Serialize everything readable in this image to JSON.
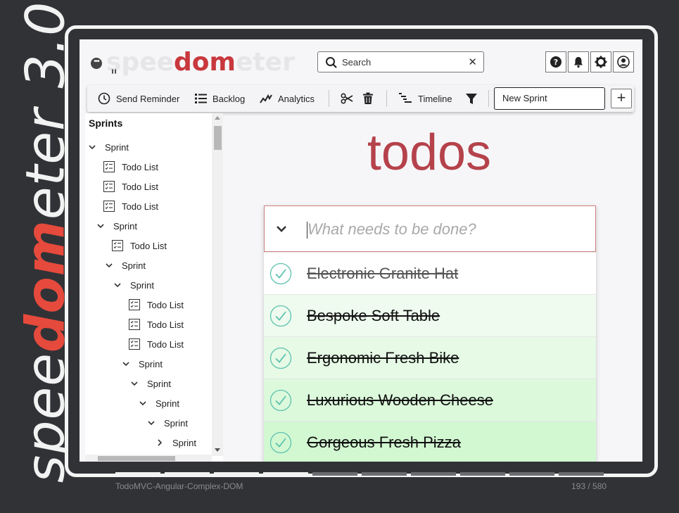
{
  "brand": {
    "pre": "spee",
    "highlight": "dom",
    "post": "eter",
    "version": "3.0"
  },
  "app": {
    "logo_pre": "spee",
    "logo_hl": "dom",
    "logo_post": "eter",
    "logo_mark": "\""
  },
  "search": {
    "value": "Search",
    "clear_icon": "close-icon"
  },
  "header_buttons": [
    "help-icon",
    "bell-icon",
    "gear-icon",
    "user-icon"
  ],
  "toolbar": {
    "send_reminder": "Send Reminder",
    "backlog": "Backlog",
    "analytics": "Analytics",
    "timeline": "Timeline",
    "new_sprint_value": "New Sprint",
    "add_label": "+"
  },
  "sidebar": {
    "title": "Sprints",
    "items": [
      {
        "type": "sprint",
        "label": "Sprint",
        "level": 0,
        "expanded": true
      },
      {
        "type": "todo",
        "label": "Todo List",
        "level": 1
      },
      {
        "type": "todo",
        "label": "Todo List",
        "level": 1
      },
      {
        "type": "todo",
        "label": "Todo List",
        "level": 1
      },
      {
        "type": "sprint",
        "label": "Sprint",
        "level": 1,
        "expanded": true
      },
      {
        "type": "todo",
        "label": "Todo List",
        "level": 2
      },
      {
        "type": "sprint",
        "label": "Sprint",
        "level": 2,
        "expanded": true
      },
      {
        "type": "sprint",
        "label": "Sprint",
        "level": 3,
        "expanded": true
      },
      {
        "type": "todo",
        "label": "Todo List",
        "level": 4
      },
      {
        "type": "todo",
        "label": "Todo List",
        "level": 4
      },
      {
        "type": "todo",
        "label": "Todo List",
        "level": 4
      },
      {
        "type": "sprint",
        "label": "Sprint",
        "level": 4,
        "expanded": true
      },
      {
        "type": "sprint",
        "label": "Sprint",
        "level": 5,
        "expanded": true
      },
      {
        "type": "sprint",
        "label": "Sprint",
        "level": 6,
        "expanded": true
      },
      {
        "type": "sprint",
        "label": "Sprint",
        "level": 7,
        "expanded": true
      },
      {
        "type": "sprint",
        "label": "Sprint",
        "level": 8,
        "expanded": false
      }
    ]
  },
  "todo_app": {
    "title": "todos",
    "placeholder": "What needs to be done?",
    "items": [
      {
        "label": "Electronic Granite Hat",
        "completed": true,
        "bg": "#ffffff",
        "color": "#555555"
      },
      {
        "label": "Bespoke Soft Table",
        "completed": true,
        "bg": "#eefbee",
        "color": "#111111"
      },
      {
        "label": "Ergonomic Fresh Bike",
        "completed": true,
        "bg": "#e6fae6",
        "color": "#111111"
      },
      {
        "label": "Luxurious Wooden Cheese",
        "completed": true,
        "bg": "#dcf9dc",
        "color": "#111111"
      },
      {
        "label": "Gorgeous Fresh Pizza",
        "completed": true,
        "bg": "#d2f8d2",
        "color": "#111111"
      }
    ]
  },
  "colors": {
    "accent": "#c8383d",
    "title": "#b5424b",
    "check": "#5dc2af",
    "brand_highlight": "#e54a3c"
  },
  "progress": {
    "done_segments": 4,
    "total_segments": 10
  },
  "footer": {
    "test_name": "TodoMVC-Angular-Complex-DOM",
    "counter": "193 / 580"
  }
}
